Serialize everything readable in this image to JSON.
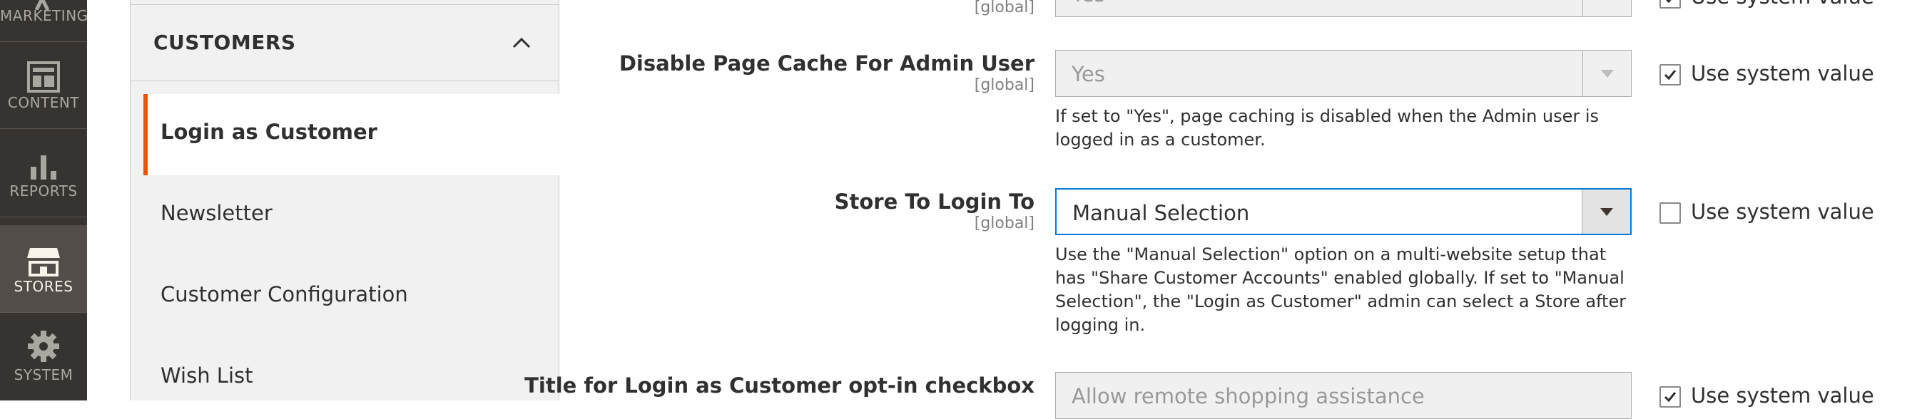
{
  "nav": {
    "items": [
      {
        "label": "MARKETING",
        "icon": "megaphone-icon"
      },
      {
        "label": "CONTENT",
        "icon": "layout-icon"
      },
      {
        "label": "REPORTS",
        "icon": "bar-chart-icon"
      },
      {
        "label": "STORES",
        "icon": "storefront-icon"
      },
      {
        "label": "SYSTEM",
        "icon": "gear-icon"
      }
    ]
  },
  "tabs": {
    "title": "CUSTOMERS",
    "items": [
      "Login as Customer",
      "Newsletter",
      "Customer Configuration",
      "Wish List"
    ]
  },
  "form": {
    "row0": {
      "scope": "[global]",
      "value": "Yes",
      "use_system": "Use system value"
    },
    "row1": {
      "label": "Disable Page Cache For Admin User",
      "scope": "[global]",
      "value": "Yes",
      "note": "If set to \"Yes\", page caching is disabled when the Admin user is logged in as a customer.",
      "use_system": "Use system value",
      "use_system_checked": true
    },
    "row2": {
      "label": "Store To Login To",
      "scope": "[global]",
      "value": "Manual Selection",
      "note": "Use the \"Manual Selection\" option on a multi-website setup that has \"Share Customer Accounts\" enabled globally. If set to \"Manual Selection\", the \"Login as Customer\" admin can select a Store after logging in.",
      "use_system": "Use system value",
      "use_system_checked": false
    },
    "row3": {
      "label": "Title for Login as Customer opt-in checkbox",
      "value": "Allow remote shopping assistance",
      "use_system": "Use system value",
      "use_system_checked": true
    }
  },
  "colors": {
    "nav_bg": "#373330",
    "nav_active": "#524d49",
    "accent": "#eb5202",
    "focus": "#007bdb"
  }
}
